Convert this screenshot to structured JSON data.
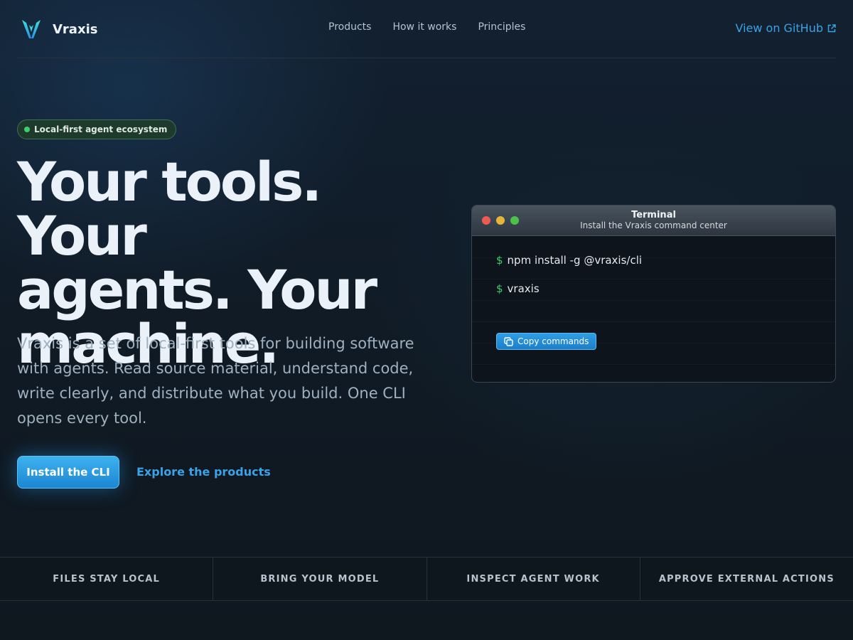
{
  "brand": {
    "name": "Vraxis",
    "logo_icon": "vraxis-logo-icon",
    "accent": "#3aa2e6"
  },
  "nav": {
    "items": [
      {
        "label": "Products"
      },
      {
        "label": "How it works"
      },
      {
        "label": "Principles"
      }
    ],
    "github_label": "View on GitHub",
    "github_icon": "external-link-icon"
  },
  "hero": {
    "badge": "Local-first agent ecosystem",
    "title_lines": [
      "Your tools. Your",
      "agents. Your",
      "machine."
    ],
    "description": "Vraxis is a set of local-first tools for building software with agents. Read source material, understand code, write clearly, and distribute what you build. One CLI opens every tool.",
    "primary_cta": "Install the CLI",
    "secondary_cta": "Explore the products"
  },
  "terminal": {
    "title": "Terminal",
    "subtitle": "Install the Vraxis command center",
    "prompt": "$",
    "commands": [
      "npm install -g @vraxis/cli",
      "vraxis"
    ],
    "copy_label": "Copy commands",
    "copy_icon": "copy-icon"
  },
  "features": [
    {
      "label": "FILES STAY LOCAL"
    },
    {
      "label": "BRING YOUR MODEL"
    },
    {
      "label": "INSPECT AGENT WORK"
    },
    {
      "label": "APPROVE EXTERNAL ACTIONS"
    }
  ]
}
